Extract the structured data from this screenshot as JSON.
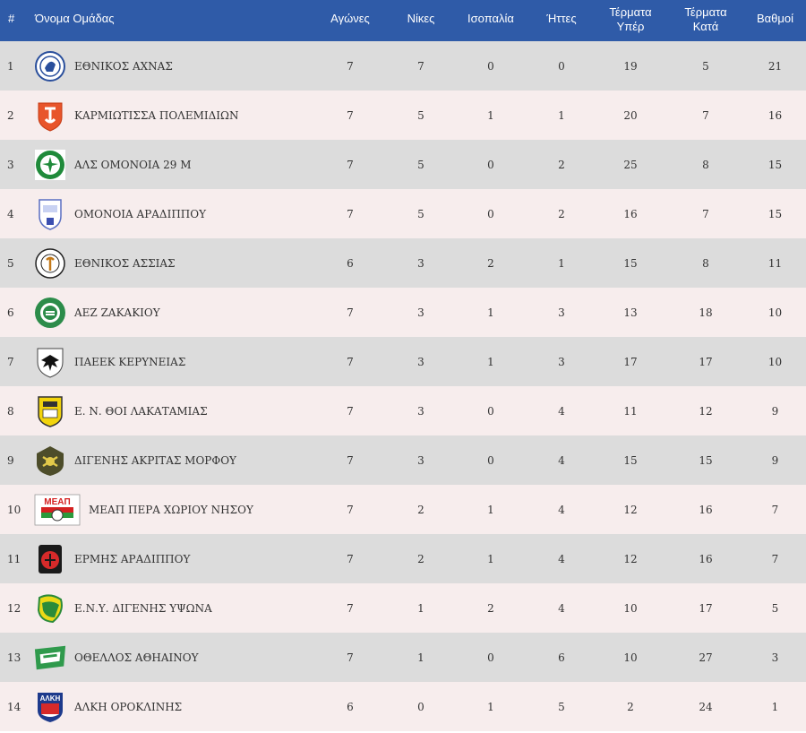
{
  "header": {
    "pos": "#",
    "team": "Όνομα Ομάδας",
    "played": "Αγώνες",
    "wins": "Νίκες",
    "draws": "Ισοπαλία",
    "losses": "Ήττες",
    "gf": [
      "Τέρματα",
      "Υπέρ"
    ],
    "ga": [
      "Τέρματα",
      "Κατά"
    ],
    "pts": "Βαθμοί"
  },
  "rows": [
    {
      "pos": "1",
      "team": "ΕΘΝΙΚΟΣ ΑΧΝΑΣ",
      "played": "7",
      "wins": "7",
      "draws": "0",
      "losses": "0",
      "gf": "19",
      "ga": "5",
      "pts": "21",
      "logo": "ethnikos-achnas-crest"
    },
    {
      "pos": "2",
      "team": "ΚΑΡΜΙΩΤΙΣΣΑ ΠΟΛΕΜΙΔΙΩΝ",
      "played": "7",
      "wins": "5",
      "draws": "1",
      "losses": "1",
      "gf": "20",
      "ga": "7",
      "pts": "16",
      "logo": "karmiotissa-crest"
    },
    {
      "pos": "3",
      "team": "ΑΛΣ ΟΜΟΝΟΙΑ 29 Μ",
      "played": "7",
      "wins": "5",
      "draws": "0",
      "losses": "2",
      "gf": "25",
      "ga": "8",
      "pts": "15",
      "logo": "omonoia-29m-crest"
    },
    {
      "pos": "4",
      "team": "ΟΜΟΝΟΙΑ ΑΡΑΔΙΠΠΟΥ",
      "played": "7",
      "wins": "5",
      "draws": "0",
      "losses": "2",
      "gf": "16",
      "ga": "7",
      "pts": "15",
      "logo": "omonoia-aradippou-crest"
    },
    {
      "pos": "5",
      "team": "ΕΘΝΙΚΟΣ ΑΣΣΙΑΣ",
      "played": "6",
      "wins": "3",
      "draws": "2",
      "losses": "1",
      "gf": "15",
      "ga": "8",
      "pts": "11",
      "logo": "ethnikos-assias-crest"
    },
    {
      "pos": "6",
      "team": "ΑΕΖ ΖΑΚΑΚΙΟΥ",
      "played": "7",
      "wins": "3",
      "draws": "1",
      "losses": "3",
      "gf": "13",
      "ga": "18",
      "pts": "10",
      "logo": "aez-zakakiou-crest"
    },
    {
      "pos": "7",
      "team": "ΠΑΕΕΚ ΚΕΡΥΝΕΙΑΣ",
      "played": "7",
      "wins": "3",
      "draws": "1",
      "losses": "3",
      "gf": "17",
      "ga": "17",
      "pts": "10",
      "logo": "paeek-crest"
    },
    {
      "pos": "8",
      "team": "Ε. Ν. ΘΟΙ ΛΑΚΑΤΑΜΙΑΣ",
      "played": "7",
      "wins": "3",
      "draws": "0",
      "losses": "4",
      "gf": "11",
      "ga": "12",
      "pts": "9",
      "logo": "thoi-crest"
    },
    {
      "pos": "9",
      "team": "ΔΙΓΕΝΗΣ ΑΚΡΙΤΑΣ ΜΟΡΦΟΥ",
      "played": "7",
      "wins": "3",
      "draws": "0",
      "losses": "4",
      "gf": "15",
      "ga": "15",
      "pts": "9",
      "logo": "digenis-morfou-crest"
    },
    {
      "pos": "10",
      "team": "ΜΕΑΠ ΠΕΡΑ ΧΩΡΙΟΥ ΝΗΣΟΥ",
      "played": "7",
      "wins": "2",
      "draws": "1",
      "losses": "4",
      "gf": "12",
      "ga": "16",
      "pts": "7",
      "logo": "meap-crest",
      "logo_text": "ΜΕΑΠ"
    },
    {
      "pos": "11",
      "team": "ΕΡΜΗΣ ΑΡΑΔΙΠΠΟΥ",
      "played": "7",
      "wins": "2",
      "draws": "1",
      "losses": "4",
      "gf": "12",
      "ga": "16",
      "pts": "7",
      "logo": "ermis-crest"
    },
    {
      "pos": "12",
      "team": "Ε.Ν.Υ. ΔΙΓΕΝΗΣ ΥΨΩΝΑ",
      "played": "7",
      "wins": "1",
      "draws": "2",
      "losses": "4",
      "gf": "10",
      "ga": "17",
      "pts": "5",
      "logo": "digenis-ypsona-crest"
    },
    {
      "pos": "13",
      "team": "ΟΘΕΛΛΟΣ ΑΘΗΑΙΝΟΥ",
      "played": "7",
      "wins": "1",
      "draws": "0",
      "losses": "6",
      "gf": "10",
      "ga": "27",
      "pts": "3",
      "logo": "othellos-crest"
    },
    {
      "pos": "14",
      "team": "ΑΛΚΗ ΟΡΟΚΛΙΝΗΣ",
      "played": "6",
      "wins": "0",
      "draws": "1",
      "losses": "5",
      "gf": "2",
      "ga": "24",
      "pts": "1",
      "logo": "alki-crest",
      "logo_text": "ΑΛΚΗ"
    }
  ],
  "colors": {
    "header_bg": "#2f5ba8",
    "row_odd": "#dcdcdc",
    "row_even": "#f7eded"
  }
}
